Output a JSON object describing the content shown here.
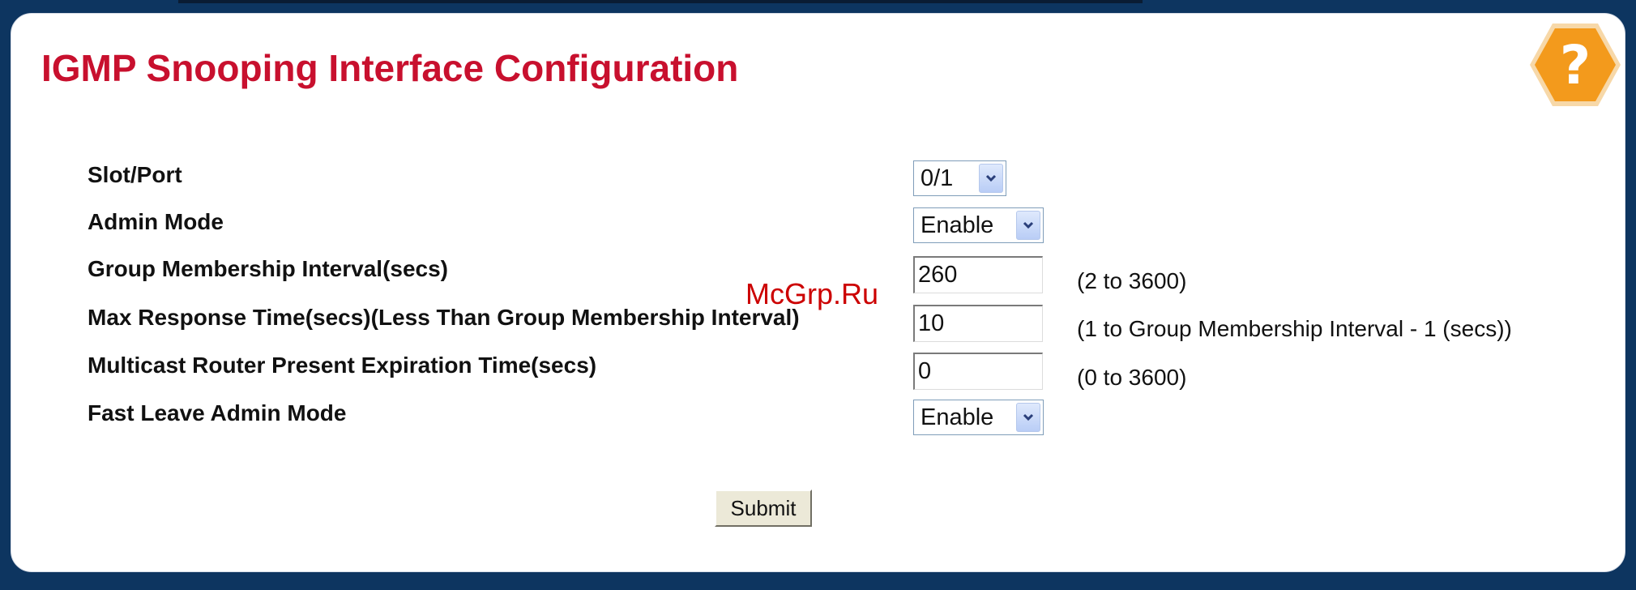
{
  "page": {
    "title": "IGMP Snooping Interface Configuration",
    "watermark": "McGrp.Ru",
    "help_glyph": "?"
  },
  "colors": {
    "title": "#c8102e",
    "background": "#0d3560",
    "help_icon": "#f39a1c"
  },
  "icons": {
    "help": "help-question-hexagon-icon",
    "dropdown": "chevron-down-icon"
  },
  "form": {
    "slot_port": {
      "label": "Slot/Port",
      "value": "0/1"
    },
    "admin_mode": {
      "label": "Admin Mode",
      "value": "Enable"
    },
    "group_membership_interval": {
      "label": "Group Membership Interval(secs)",
      "value": "260",
      "hint": "(2 to 3600)"
    },
    "max_response_time": {
      "label": "Max Response Time(secs)(Less Than Group Membership Interval)",
      "value": "10",
      "hint": "(1 to Group Membership Interval - 1 (secs))"
    },
    "mcast_router_expiration": {
      "label": "Multicast Router Present Expiration Time(secs)",
      "value": "0",
      "hint": "(0 to 3600)"
    },
    "fast_leave_admin_mode": {
      "label": "Fast Leave Admin Mode",
      "value": "Enable"
    },
    "submit_label": "Submit"
  }
}
